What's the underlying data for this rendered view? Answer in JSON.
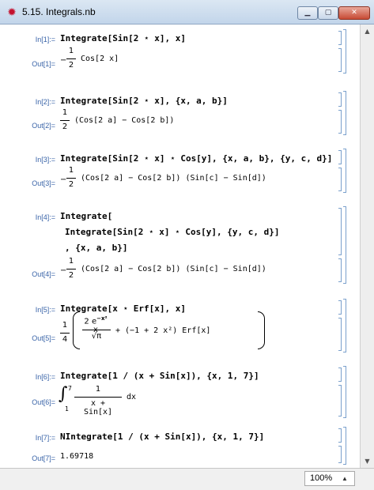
{
  "window": {
    "title": "5.15. Integrals.nb",
    "app_icon": "mathematica-star-icon"
  },
  "colors": {
    "label": "#3a64a8",
    "symbol": "#2431a8",
    "bracket": "#7aa0cc",
    "close": "#c74a34"
  },
  "cells": {
    "in1": {
      "label": "In[1]:=",
      "code": "Integrate[Sin[2 ⋆ x], x]"
    },
    "out1": {
      "label": "Out[1]=",
      "sign": "−",
      "num": "1",
      "den": "2",
      "expr": "Cos[2 x]"
    },
    "in2": {
      "label": "In[2]:=",
      "code": "Integrate[Sin[2 ⋆ x], {x, a, b}]"
    },
    "out2": {
      "label": "Out[2]=",
      "num": "1",
      "den": "2",
      "expr": "(Cos[2 a] − Cos[2 b])"
    },
    "in3": {
      "label": "In[3]:=",
      "code": "Integrate[Sin[2 ⋆ x] ⋆ Cos[y], {x, a, b}, {y, c, d}]"
    },
    "out3": {
      "label": "Out[3]=",
      "sign": "−",
      "num": "1",
      "den": "2",
      "expr": "(Cos[2 a] − Cos[2 b]) (Sin[c] − Sin[d])"
    },
    "in4": {
      "label": "In[4]:=",
      "line1": "Integrate[",
      "line2": "Integrate[Sin[2 ⋆ x] ⋆ Cos[y], {y, c, d}]",
      "line3": ", {x, a, b}]"
    },
    "out4": {
      "label": "Out[4]=",
      "sign": "−",
      "num": "1",
      "den": "2",
      "expr": "(Cos[2 a] − Cos[2 b]) (Sin[c] − Sin[d])"
    },
    "in5": {
      "label": "In[5]:=",
      "code": "Integrate[x ⋆ Erf[x], x]"
    },
    "out5": {
      "label": "Out[5]=",
      "num": "1",
      "den": "4",
      "inner_num": "2 e",
      "inner_exp": "−x²",
      "inner_x": "x",
      "inner_den": "√π",
      "rest": "+ (−1 + 2 x²) Erf[x]"
    },
    "in6": {
      "label": "In[6]:=",
      "code": "Integrate[1 / (x + Sin[x]), {x, 1, 7}]"
    },
    "out6": {
      "label": "Out[6]=",
      "upper": "7",
      "lower": "1",
      "num": "1",
      "den": "x + Sin[x]",
      "dx": "dx"
    },
    "in7": {
      "label": "In[7]:=",
      "code": "NIntegrate[1 / (x + Sin[x]), {x, 1, 7}]"
    },
    "out7": {
      "label": "Out[7]=",
      "value": "1.69718"
    }
  },
  "status": {
    "zoom": "100%"
  }
}
